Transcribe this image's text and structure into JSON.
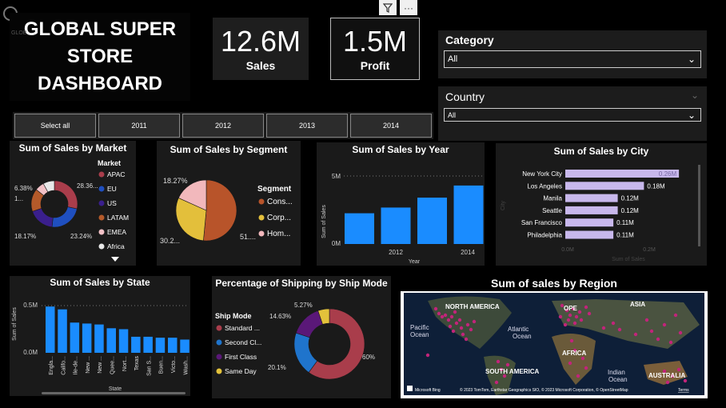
{
  "header": {
    "title": "GLOBAL SUPER\nSTORE\nDASHBOARD",
    "ghost_text": "GLOB"
  },
  "kpis": {
    "sales": {
      "value": "12.6M",
      "label": "Sales"
    },
    "profit": {
      "value": "1.5M",
      "label": "Profit"
    }
  },
  "toolbar": {
    "filter_icon": "filter-icon",
    "more_icon": "more-options-icon"
  },
  "slicers": {
    "category": {
      "label": "Category",
      "value": "All"
    },
    "country": {
      "label": "Country",
      "value": "All"
    }
  },
  "year_buttons": [
    "Select all",
    "2011",
    "2012",
    "2013",
    "2014"
  ],
  "chart_data": [
    {
      "type": "pie",
      "title": "Sum of Sales by Market",
      "legend_title": "Market",
      "legend_position": "right",
      "categories": [
        "APAC",
        "EU",
        "US",
        "LATAM",
        "EMEA",
        "Africa"
      ],
      "values": [
        28.36,
        23.24,
        18.17,
        15.9,
        6.38,
        7.9
      ],
      "colors": [
        "#a93d4b",
        "#1f4fbf",
        "#3a1f8c",
        "#b45a2a",
        "#f2c1c6",
        "#e8e8e8"
      ],
      "data_labels": [
        "28.36...",
        "23.24%",
        "18.17%",
        "1...",
        "6.38%"
      ]
    },
    {
      "type": "pie",
      "title": "Sum of Sales by Segment",
      "legend_title": "Segment",
      "legend_position": "right",
      "categories": [
        "Cons...",
        "Corp...",
        "Hom..."
      ],
      "values": [
        51.5,
        30.2,
        18.27
      ],
      "colors": [
        "#b8542a",
        "#e3bf3b",
        "#f2b8bc"
      ],
      "data_labels": [
        "51....",
        "30.2...",
        "18.27%"
      ]
    },
    {
      "type": "bar",
      "title": "Sum of Sales by Year",
      "x": [
        2011,
        2012,
        2013,
        2014
      ],
      "values": [
        2.26,
        2.68,
        3.41,
        4.3
      ],
      "xlabel": "Year",
      "ylabel": "Sum of Sales",
      "x_ticks": [
        "2012",
        "2014"
      ],
      "y_ticks": [
        "0M",
        "5M"
      ],
      "ylim": [
        0,
        5
      ]
    },
    {
      "type": "bar",
      "orientation": "horizontal",
      "title": "Sum of Sales by City",
      "categories": [
        "New York City",
        "Los Angeles",
        "Manila",
        "Seattle",
        "San Francisco",
        "Philadelphia"
      ],
      "values": [
        0.26,
        0.18,
        0.12,
        0.12,
        0.11,
        0.11
      ],
      "data_labels": [
        "0.26M",
        "0.18M",
        "0.12M",
        "0.12M",
        "0.11M",
        "0.11M"
      ],
      "xlabel": "Sum of Sales",
      "ylabel": "City",
      "x_ticks": [
        "0.0M",
        "0.2M"
      ],
      "xlim": [
        0,
        0.3
      ]
    },
    {
      "type": "bar",
      "title": "Sum of Sales by State",
      "categories": [
        "Engla...",
        "Califo...",
        "Ile-de...",
        "New ...",
        "New ...",
        "Quee...",
        "Nort...",
        "Texas",
        "San S...",
        "Buen...",
        "Victo...",
        "Wash..."
      ],
      "values": [
        0.49,
        0.46,
        0.32,
        0.31,
        0.3,
        0.26,
        0.25,
        0.17,
        0.17,
        0.16,
        0.16,
        0.14
      ],
      "xlabel": "State",
      "ylabel": "Sum of Sales",
      "y_ticks": [
        "0.0M",
        "0.5M"
      ],
      "ylim": [
        0,
        0.6
      ]
    },
    {
      "type": "pie",
      "donut": true,
      "title": "Percentage of Shipping by Ship Mode",
      "legend_title": "Ship Mode",
      "legend_position": "left",
      "categories": [
        "Standard ...",
        "Second Cl...",
        "First Class",
        "Same Day"
      ],
      "values": [
        60,
        20.1,
        14.63,
        5.27
      ],
      "colors": [
        "#a93d4b",
        "#1f74cc",
        "#5a1878",
        "#e3c23b"
      ],
      "data_labels": [
        "60%",
        "20.1%",
        "14.63%",
        "5.27%"
      ]
    }
  ],
  "map": {
    "title": "Sum of sales by Region",
    "labels": {
      "north_america": "NORTH AMERICA",
      "europe": "OPE",
      "asia": "ASIA",
      "pacific": "Pacific\nOcean",
      "atlantic": "Atlantic\nOcean",
      "africa": "AFRICA",
      "south_america": "SOUTH AMERICA",
      "indian": "Indian\nOcean",
      "australia": "AUSTRALIA"
    },
    "bing": "Microsoft Bing",
    "attribution": "© 2023 TomTom, Earthstar Geographics SIO, © 2023 Microsoft Corporation, © OpenStreetMap",
    "terms": "Terms"
  }
}
